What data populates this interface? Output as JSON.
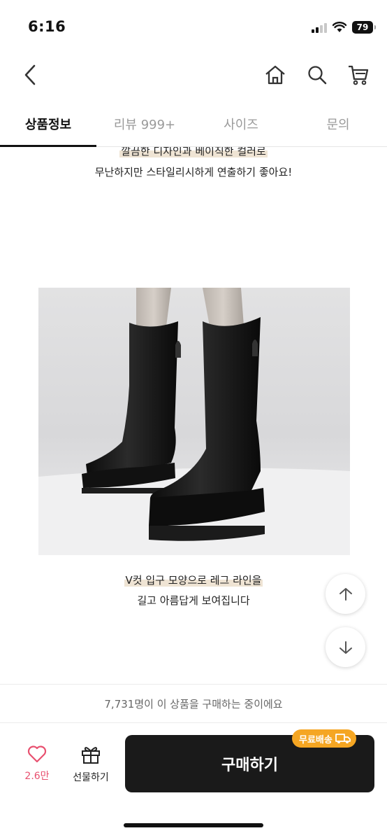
{
  "status": {
    "time": "6:16",
    "battery": "79"
  },
  "tabs": [
    {
      "label": "상품정보",
      "active": true
    },
    {
      "label": "리뷰 999+",
      "active": false
    },
    {
      "label": "사이즈",
      "active": false
    },
    {
      "label": "문의",
      "active": false
    }
  ],
  "content": {
    "caption_top_1": "깔끔한 디자인과 베이직한 컬러로",
    "caption_top_2": "무난하지만 스타일리시하게 연출하기 좋아요!",
    "caption_bottom_1": "V컷 입구 모양으로 레그 라인을",
    "caption_bottom_2": "길고 아름답게 보여집니다"
  },
  "purchase_info": "7,731명이 이 상품을 구매하는 중이에요",
  "actions": {
    "like_count": "2.6만",
    "gift_label": "선물하기",
    "buy_label": "구매하기",
    "free_shipping_badge": "무료배송"
  },
  "colors": {
    "accent_like": "#e8506f",
    "badge": "#f5a623",
    "buy_button": "#1a1a1a",
    "highlight": "#efe4d4"
  },
  "icons": [
    "back-icon",
    "home-icon",
    "search-icon",
    "cart-icon",
    "arrow-up-icon",
    "arrow-down-icon",
    "heart-icon",
    "gift-icon",
    "truck-icon"
  ]
}
